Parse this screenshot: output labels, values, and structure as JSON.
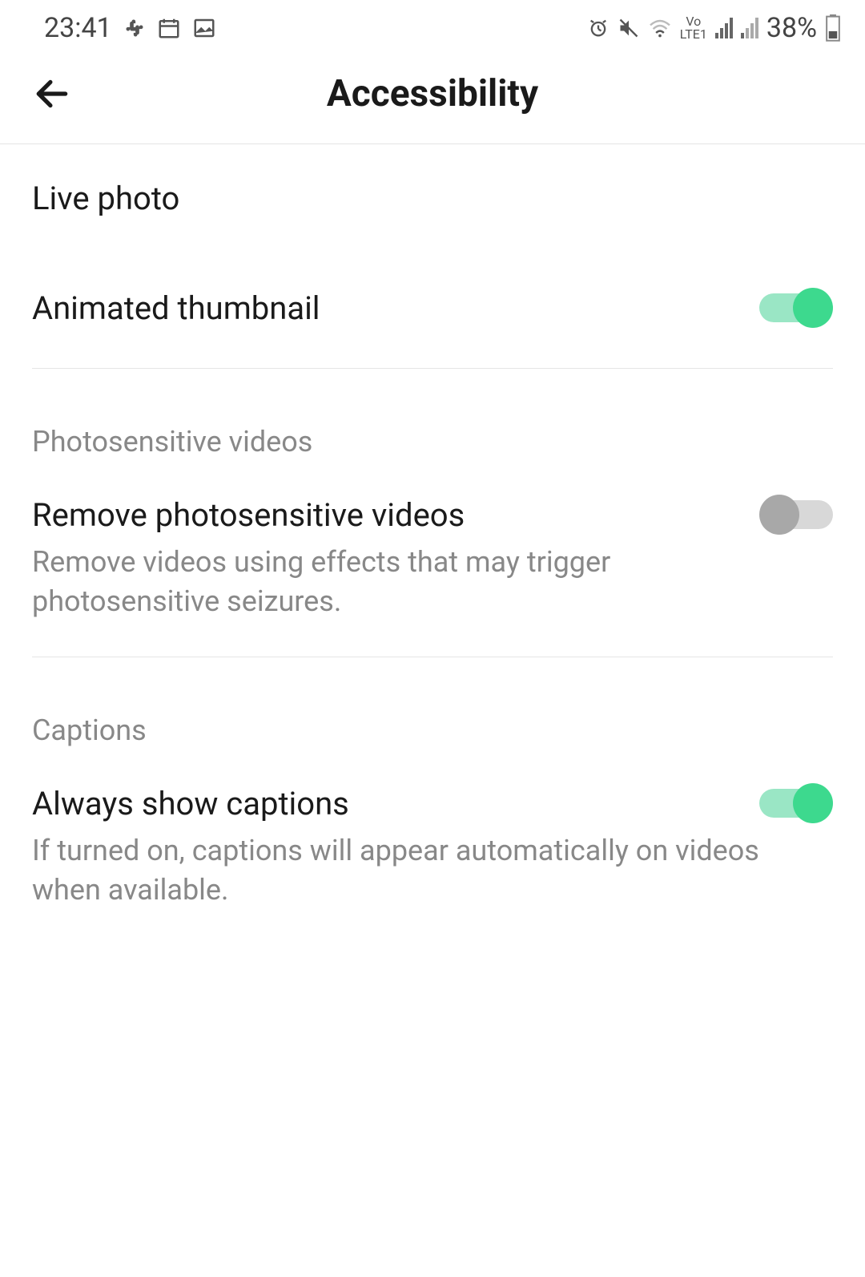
{
  "statusBar": {
    "time": "23:41",
    "batteryText": "38%",
    "lteLabel": "LTE1",
    "voLabel": "Vo"
  },
  "header": {
    "title": "Accessibility"
  },
  "items": {
    "livePhoto": {
      "label": "Live photo"
    },
    "animatedThumbnail": {
      "label": "Animated thumbnail",
      "on": true
    }
  },
  "sections": {
    "photosensitive": {
      "header": "Photosensitive videos",
      "item": {
        "title": "Remove photosensitive videos",
        "desc": "Remove videos using effects that may trigger photosensitive seizures.",
        "on": false
      }
    },
    "captions": {
      "header": "Captions",
      "item": {
        "title": "Always show captions",
        "desc": "If turned on, captions will appear automatically on videos when available.",
        "on": true
      }
    }
  }
}
